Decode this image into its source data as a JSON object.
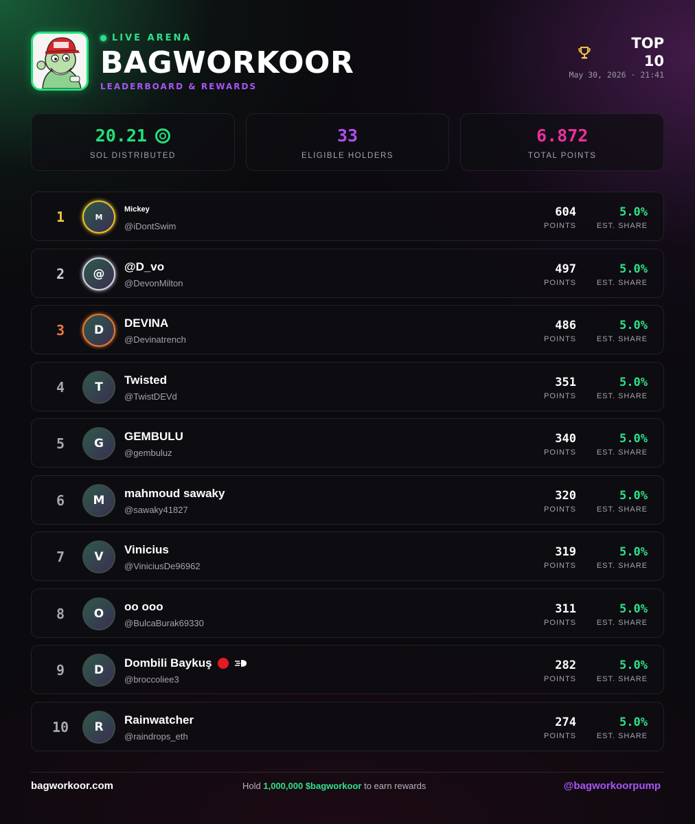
{
  "header": {
    "live_label": "LIVE ARENA",
    "brand": "BAGWORKOOR",
    "subtitle": "LEADERBOARD & REWARDS",
    "top_label": "TOP 10",
    "date": "May 30, 2026 · 21:41",
    "logo_icon": "pepe-maga-hat-avatar",
    "trophy_icon": "trophy-icon"
  },
  "stats": [
    {
      "value": "20.21",
      "label": "SOL DISTRIBUTED",
      "color": "#22e07a",
      "icon": "sol-coin-icon"
    },
    {
      "value": "33",
      "label": "ELIGIBLE HOLDERS",
      "color": "#b04cf0"
    },
    {
      "value": "6.872",
      "label": "TOTAL POINTS",
      "color": "#ec2f9e"
    }
  ],
  "columns": {
    "points": "POINTS",
    "share": "EST. SHARE"
  },
  "leaderboard": [
    {
      "rank": "1",
      "initial": "M",
      "name": "Mickey",
      "handle": "@iDontSwim",
      "points": "604",
      "share": "5.0%",
      "rank_color": "#f5c542",
      "ring_color": "#e9c02e"
    },
    {
      "rank": "2",
      "initial": "@",
      "name": "@D_vo",
      "handle": "@DevonMilton",
      "points": "497",
      "share": "5.0%",
      "rank_color": "#c9ccd4",
      "ring_color": "#d2d6de"
    },
    {
      "rank": "3",
      "initial": "D",
      "name": "DEVINA",
      "handle": "@Devinatrench",
      "points": "486",
      "share": "5.0%",
      "rank_color": "#f0793a",
      "ring_color": "#e8782f"
    },
    {
      "rank": "4",
      "initial": "T",
      "name": "Twisted",
      "handle": "@TwistDEVd",
      "points": "351",
      "share": "5.0%"
    },
    {
      "rank": "5",
      "initial": "G",
      "name": "GEMBULU",
      "handle": "@gembuluz",
      "points": "340",
      "share": "5.0%"
    },
    {
      "rank": "6",
      "initial": "M",
      "name": "mahmoud sawaky",
      "handle": "@sawaky41827",
      "points": "320",
      "share": "5.0%"
    },
    {
      "rank": "7",
      "initial": "V",
      "name": "Vinicius",
      "handle": "@ViniciusDe96962",
      "points": "319",
      "share": "5.0%"
    },
    {
      "rank": "8",
      "initial": "O",
      "name": "oo ooo",
      "handle": "@BulcaBurak69330",
      "points": "311",
      "share": "5.0%"
    },
    {
      "rank": "9",
      "initial": "D",
      "name": "Dombili Baykuş",
      "handle": "@broccoliee3",
      "points": "282",
      "share": "5.0%",
      "name_icons": [
        "red-circle-icon",
        "dash-arrow-icon"
      ]
    },
    {
      "rank": "10",
      "initial": "R",
      "name": "Rainwatcher",
      "handle": "@raindrops_eth",
      "points": "274",
      "share": "5.0%"
    }
  ],
  "footer": {
    "site": "bagworkoor.com",
    "hold_prefix": "Hold",
    "hold_amount": "1,000,000 $bagworkoor",
    "hold_suffix": "to earn rewards",
    "handle": "@bagworkoorpump"
  }
}
